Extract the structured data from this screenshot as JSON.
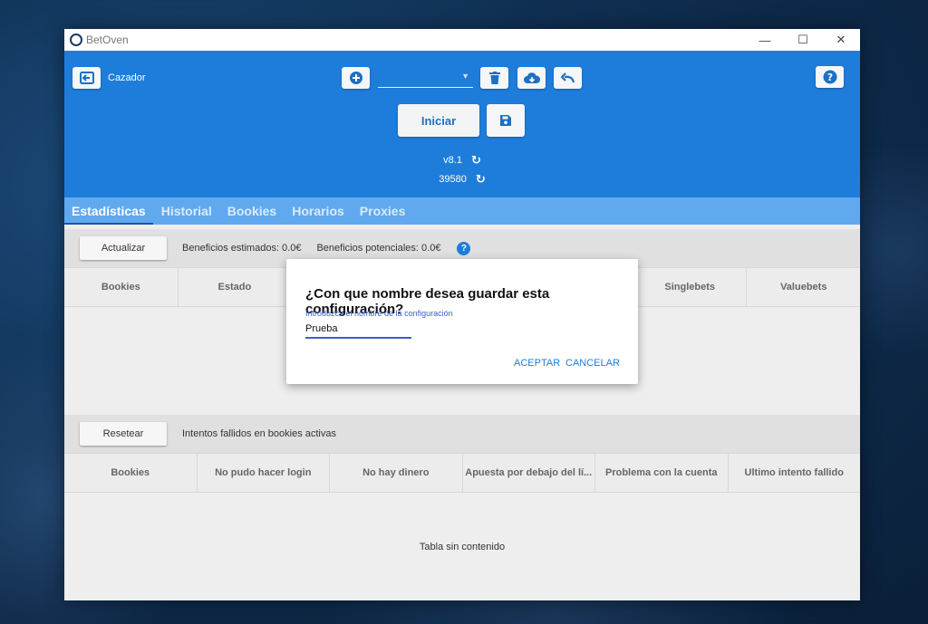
{
  "window": {
    "title": "BetOven",
    "controls": {
      "minimize": "—",
      "maximize": "☐",
      "close": "✕"
    }
  },
  "header": {
    "profile_label": "Cazador",
    "config_select_value": "",
    "start_label": "Iniciar",
    "version": "v8.1",
    "counter": "39580"
  },
  "tabs": [
    "Estadísticas",
    "Historial",
    "Bookies",
    "Horarios",
    "Proxies"
  ],
  "stats": {
    "update_label": "Actualizar",
    "estimated": "Beneficios estimados: 0.0€",
    "potential": "Beneficios potenciales: 0.0€",
    "columns": [
      "Bookies",
      "Estado",
      "",
      "",
      "",
      "Singlebets",
      "Valuebets"
    ]
  },
  "failures": {
    "reset_label": "Resetear",
    "info": "Intentos fallidos en bookies activas",
    "columns": [
      "Bookies",
      "No pudo hacer login",
      "No hay dinero",
      "Apuesta por debajo del lí...",
      "Problema con la cuenta",
      "Ultimo intento fallido"
    ],
    "empty_text": "Tabla sin contenido"
  },
  "dialog": {
    "title": "¿Con que nombre desea guardar esta configuración?",
    "field_label": "Introduzca el nombre de la configuración",
    "field_value": "Prueba",
    "accept": "ACEPTAR",
    "cancel": "CANCELAR"
  },
  "colors": {
    "primary": "#1e7ddb",
    "tabs_bg": "#61a9ef",
    "accent_underline": "#3a5fc7"
  }
}
